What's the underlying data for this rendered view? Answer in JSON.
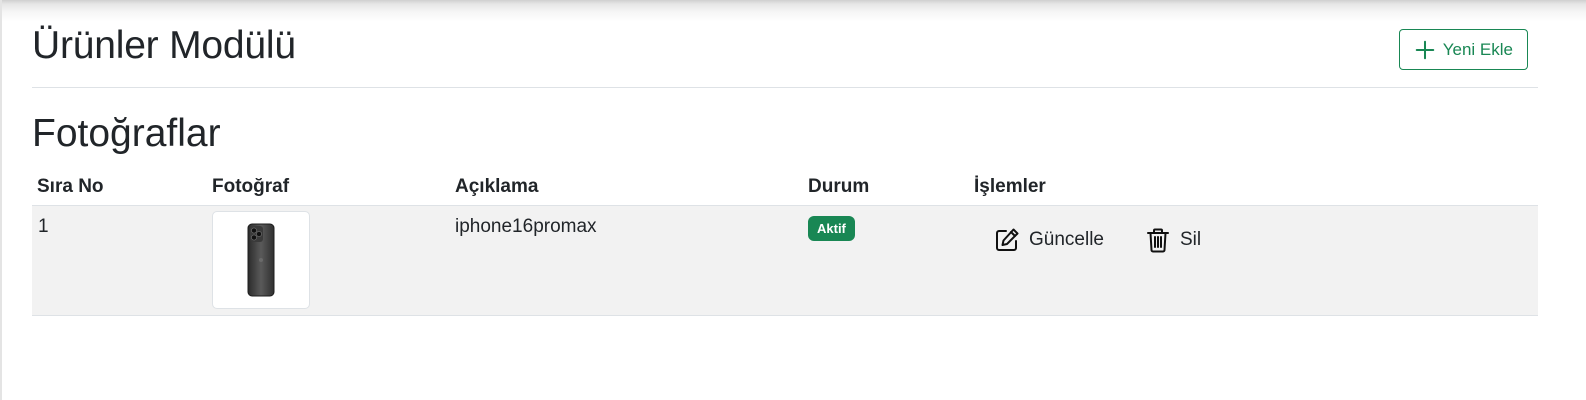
{
  "header": {
    "title": "Ürünler Modülü",
    "add_button_label": "Yeni Ekle",
    "add_icon": "plus-icon"
  },
  "section": {
    "title": "Fotoğraflar"
  },
  "table": {
    "columns": [
      "Sıra No",
      "Fotoğraf",
      "Açıklama",
      "Durum",
      "İşlemler"
    ],
    "rows": [
      {
        "order": "1",
        "photo_icon": "phone-icon",
        "description": "iphone16promax",
        "status": "Aktif",
        "actions": {
          "update_label": "Güncelle",
          "update_icon": "edit-icon",
          "delete_label": "Sil",
          "delete_icon": "trash-icon"
        }
      }
    ]
  },
  "colors": {
    "accent": "#198754",
    "row_bg": "#f2f2f2",
    "text": "#212529"
  }
}
